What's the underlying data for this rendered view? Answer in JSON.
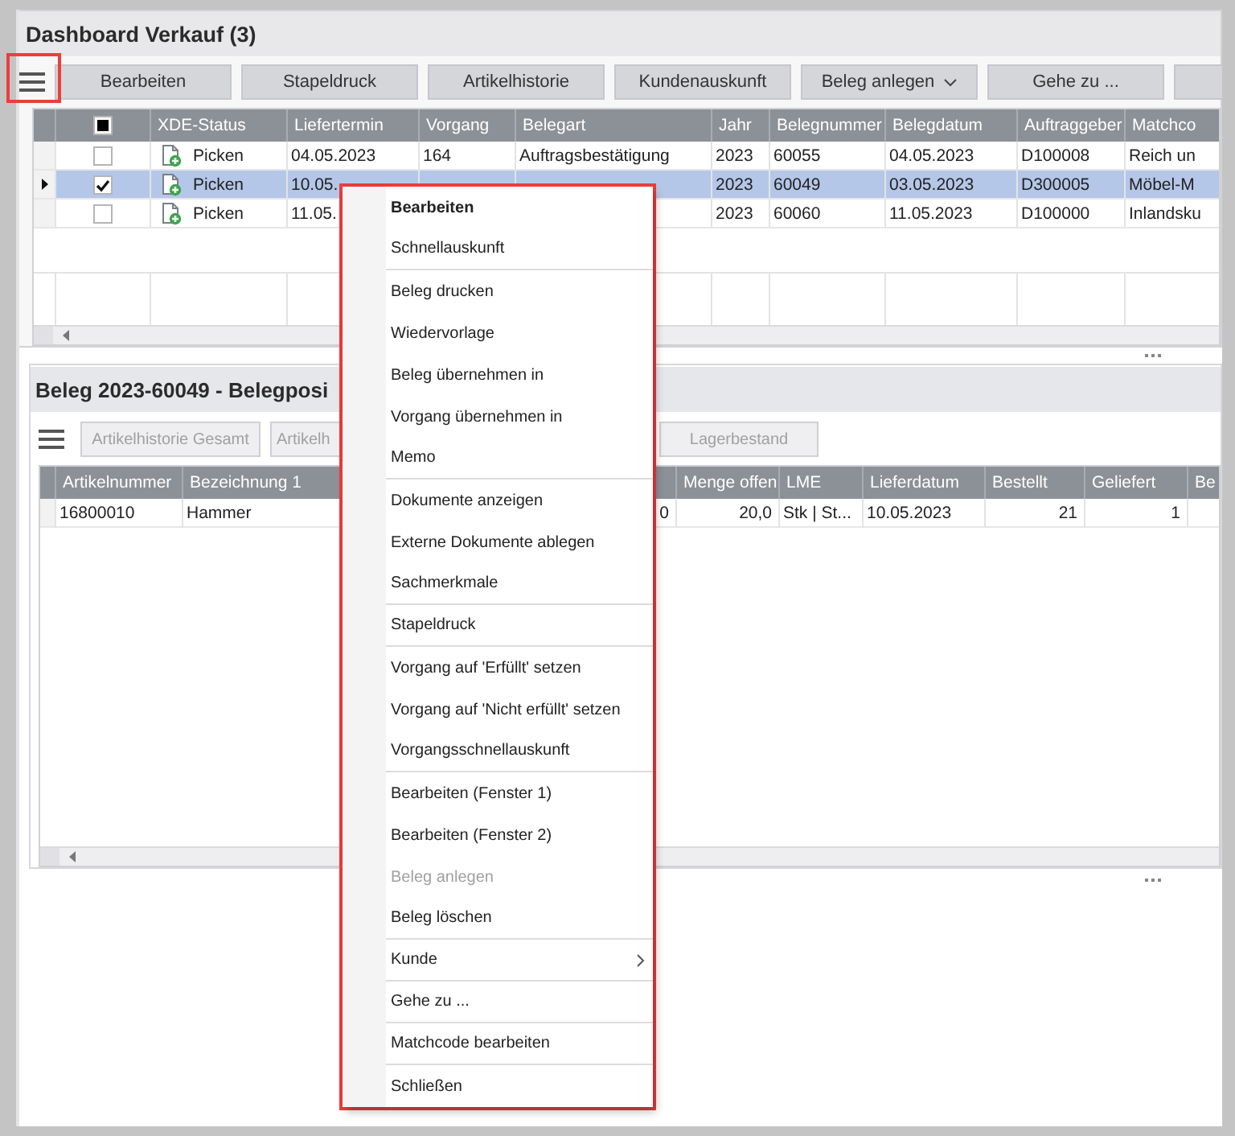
{
  "window": {
    "title": "Dashboard Verkauf (3)"
  },
  "menu_button": {
    "highlighted": true
  },
  "toolbar": [
    {
      "label": "Bearbeiten",
      "dropdown": false
    },
    {
      "label": "Stapeldruck",
      "dropdown": false
    },
    {
      "label": "Artikelhistorie",
      "dropdown": false
    },
    {
      "label": "Kundenauskunft",
      "dropdown": false
    },
    {
      "label": "Beleg anlegen",
      "dropdown": true
    },
    {
      "label": "Gehe zu ...",
      "dropdown": false
    },
    {
      "dropdown": false
    }
  ],
  "orders": {
    "select_all": {
      "indeterminate": true
    },
    "columns": [
      "XDE-Status",
      "Liefertermin",
      "Vorgang",
      "Belegart",
      "Jahr",
      "Belegnummer",
      "Belegdatum",
      "Auftraggeber",
      "Matchco"
    ],
    "rows": [
      {
        "current": false,
        "selected": false,
        "checked": false,
        "cells": [
          "Picken",
          "04.05.2023",
          "164",
          "Auftragsbestätigung",
          "2023",
          "60055",
          "04.05.2023",
          "D100008",
          "Reich un"
        ]
      },
      {
        "current": true,
        "selected": true,
        "checked": true,
        "cells": [
          "Picken",
          "10.05.",
          null,
          null,
          "2023",
          "60049",
          "03.05.2023",
          "D300005",
          "Möbel-M"
        ]
      },
      {
        "current": false,
        "selected": false,
        "checked": false,
        "cells": [
          "Picken",
          "11.05.",
          null,
          null,
          "2023",
          "60060",
          "11.05.2023",
          "D100000",
          "Inlandsku"
        ]
      }
    ]
  },
  "positions": {
    "title": "Beleg 2023-60049 - Belegposi",
    "toolbar": [
      {
        "label": "Artikelhistorie Gesamt",
        "disabled": true
      },
      {
        "label": "Artikelh",
        "disabled": true
      },
      {
        "label": "Lagerbestand",
        "disabled": true
      }
    ],
    "columns": [
      "Artikelnummer",
      "Bezeichnung 1",
      null,
      "Menge offen",
      "LME",
      "Lieferdatum",
      "Bestellt",
      "Geliefert",
      "Be"
    ],
    "rows": [
      {
        "cells": [
          "16800010",
          "Hammer",
          "0",
          "20,0",
          "Stk | St...",
          "10.05.2023",
          "21",
          "1",
          null
        ]
      }
    ]
  },
  "context_menu": {
    "highlighted": true,
    "items": [
      {
        "label": "Bearbeiten",
        "default": true,
        "disabled": false,
        "submenu": false,
        "divider_after": false
      },
      {
        "label": "Schnellauskunft",
        "default": false,
        "disabled": false,
        "submenu": false,
        "divider_after": true
      },
      {
        "label": "Beleg drucken",
        "default": false,
        "disabled": false,
        "submenu": false,
        "divider_after": false
      },
      {
        "label": "Wiedervorlage",
        "default": false,
        "disabled": false,
        "submenu": false,
        "divider_after": false
      },
      {
        "label": "Beleg übernehmen in",
        "default": false,
        "disabled": false,
        "submenu": false,
        "divider_after": false
      },
      {
        "label": "Vorgang übernehmen in",
        "default": false,
        "disabled": false,
        "submenu": false,
        "divider_after": false
      },
      {
        "label": "Memo",
        "default": false,
        "disabled": false,
        "submenu": false,
        "divider_after": true
      },
      {
        "label": "Dokumente anzeigen",
        "default": false,
        "disabled": false,
        "submenu": false,
        "divider_after": false
      },
      {
        "label": "Externe Dokumente ablegen",
        "default": false,
        "disabled": false,
        "submenu": false,
        "divider_after": false
      },
      {
        "label": "Sachmerkmale",
        "default": false,
        "disabled": false,
        "submenu": false,
        "divider_after": true
      },
      {
        "label": "Stapeldruck",
        "default": false,
        "disabled": false,
        "submenu": false,
        "divider_after": true
      },
      {
        "label": "Vorgang auf 'Erfüllt' setzen",
        "default": false,
        "disabled": false,
        "submenu": false,
        "divider_after": false
      },
      {
        "label": "Vorgang auf 'Nicht erfüllt' setzen",
        "default": false,
        "disabled": false,
        "submenu": false,
        "divider_after": false
      },
      {
        "label": "Vorgangsschnellauskunft",
        "default": false,
        "disabled": false,
        "submenu": false,
        "divider_after": true
      },
      {
        "label": "Bearbeiten (Fenster 1)",
        "default": false,
        "disabled": false,
        "submenu": false,
        "divider_after": false
      },
      {
        "label": "Bearbeiten (Fenster 2)",
        "default": false,
        "disabled": false,
        "submenu": false,
        "divider_after": false
      },
      {
        "label": "Beleg anlegen",
        "default": false,
        "disabled": true,
        "submenu": false,
        "divider_after": false
      },
      {
        "label": "Beleg löschen",
        "default": false,
        "disabled": false,
        "submenu": false,
        "divider_after": true
      },
      {
        "label": "Kunde",
        "default": false,
        "disabled": false,
        "submenu": true,
        "divider_after": true
      },
      {
        "label": "Gehe zu ...",
        "default": false,
        "disabled": false,
        "submenu": false,
        "divider_after": true
      },
      {
        "label": "Matchcode bearbeiten",
        "default": false,
        "disabled": false,
        "submenu": false,
        "divider_after": true
      },
      {
        "label": "Schließen",
        "default": false,
        "disabled": false,
        "submenu": false,
        "divider_after": false
      }
    ]
  }
}
